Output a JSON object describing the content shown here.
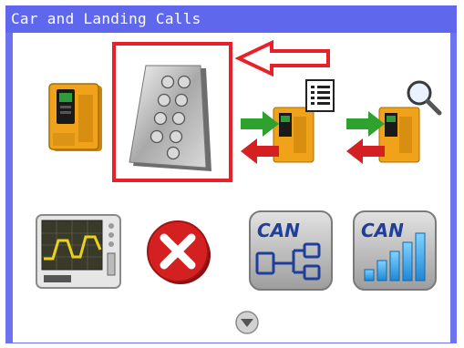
{
  "window": {
    "title": "Car and Landing Calls"
  },
  "toolbar": [
    {
      "id": "drive",
      "icon": "elevator-drive-icon"
    },
    {
      "id": "car-landing-calls",
      "icon": "keypad-panel-icon",
      "selected": true
    },
    {
      "id": "transfer-list",
      "icon": "transfer-list-icon"
    },
    {
      "id": "transfer-search",
      "icon": "transfer-search-icon"
    },
    {
      "id": "monitor",
      "icon": "oscilloscope-icon"
    },
    {
      "id": "close",
      "icon": "close-icon"
    },
    {
      "id": "can-network",
      "icon": "can-network-icon",
      "label": "CAN"
    },
    {
      "id": "can-signal",
      "icon": "can-signal-icon",
      "label": "CAN"
    }
  ],
  "colors": {
    "title_bg": "#5f68ec",
    "highlight": "#e8202a",
    "drive_body": "#f0a21a",
    "close_red": "#d42020",
    "can_blue": "#1e3f9a"
  },
  "annotations": {
    "highlight_box": "red-rectangle",
    "pointer": "red-outline-arrow"
  },
  "nav": {
    "scroll_down_icon": "chevron-down-circle-icon"
  }
}
